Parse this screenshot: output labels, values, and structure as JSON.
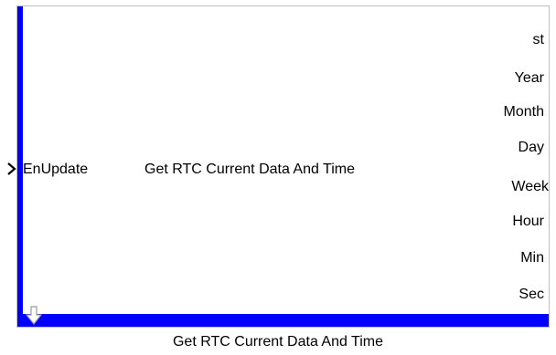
{
  "block": {
    "input_port": "EnUpdate",
    "function_name": "Get RTC Current Data And Time",
    "output_ports": [
      "st",
      "Year",
      "Month",
      "Day",
      "Week",
      "Hour",
      "Min",
      "Sec"
    ],
    "caption": "Get RTC Current Data And Time"
  },
  "colors": {
    "accent": "#0000ff",
    "border": "#bfbfbf"
  },
  "icons": {
    "input": "chevron-right-icon",
    "down": "down-arrow-icon"
  }
}
